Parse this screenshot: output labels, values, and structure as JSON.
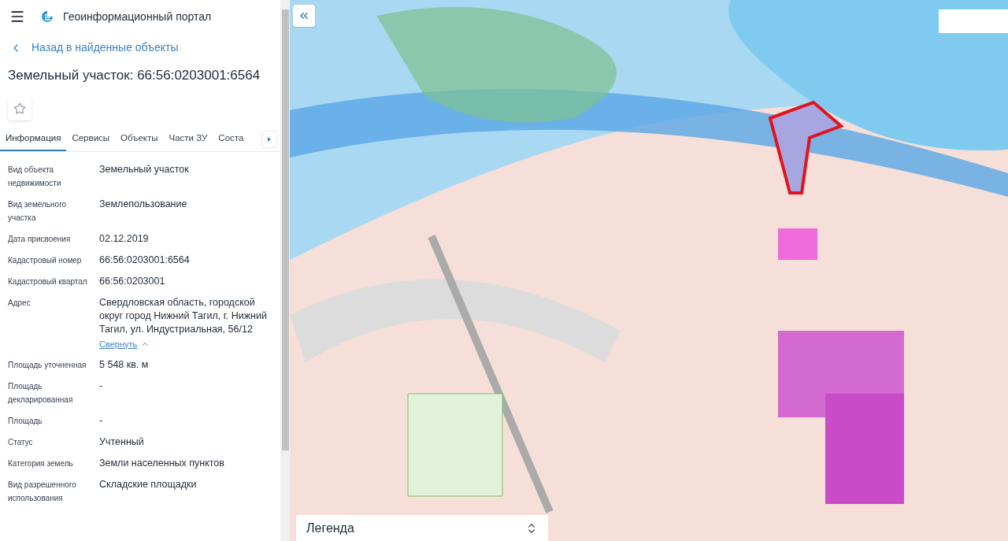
{
  "header": {
    "title": "Геоинформационный портал"
  },
  "back_link": "Назад в найденные объекты",
  "object_title": "Земельный участок: 66:56:0203001:6564",
  "favorite": {
    "starred": false
  },
  "tabs": [
    {
      "label": "Информация",
      "selected": true
    },
    {
      "label": "Сервисы",
      "selected": false
    },
    {
      "label": "Объекты",
      "selected": false
    },
    {
      "label": "Части ЗУ",
      "selected": false
    },
    {
      "label": "Соста",
      "selected": false
    }
  ],
  "properties": [
    {
      "label": "Вид объекта недвижимости",
      "value": "Земельный участок"
    },
    {
      "label": "Вид земельного участка",
      "value": "Землепользование"
    },
    {
      "label": "Дата присвоения",
      "value": "02.12.2019"
    },
    {
      "label": "Кадастровый номер",
      "value": "66:56:0203001:6564"
    },
    {
      "label": "Кадастровый квартал",
      "value": "66:56:0203001"
    },
    {
      "label": "Адрес",
      "value": "Свердловская область, городской округ город Нижний Тагил, г. Нижний Тагил, ул. Индустриальная, 56/12",
      "toggle": "Свернуть",
      "expanded": true
    },
    {
      "label": "Площадь уточненная",
      "value": "5 548 кв. м"
    },
    {
      "label": "Площадь декларированная",
      "value": "-"
    },
    {
      "label": "Площадь",
      "value": "-"
    },
    {
      "label": "Статус",
      "value": "Учтенный"
    },
    {
      "label": "Категория земель",
      "value": "Земли населенных пунктов"
    },
    {
      "label": "Вид разрешенного использования",
      "value": "Складские площадки"
    }
  ],
  "map": {
    "legend": {
      "label": "Легенда"
    }
  }
}
